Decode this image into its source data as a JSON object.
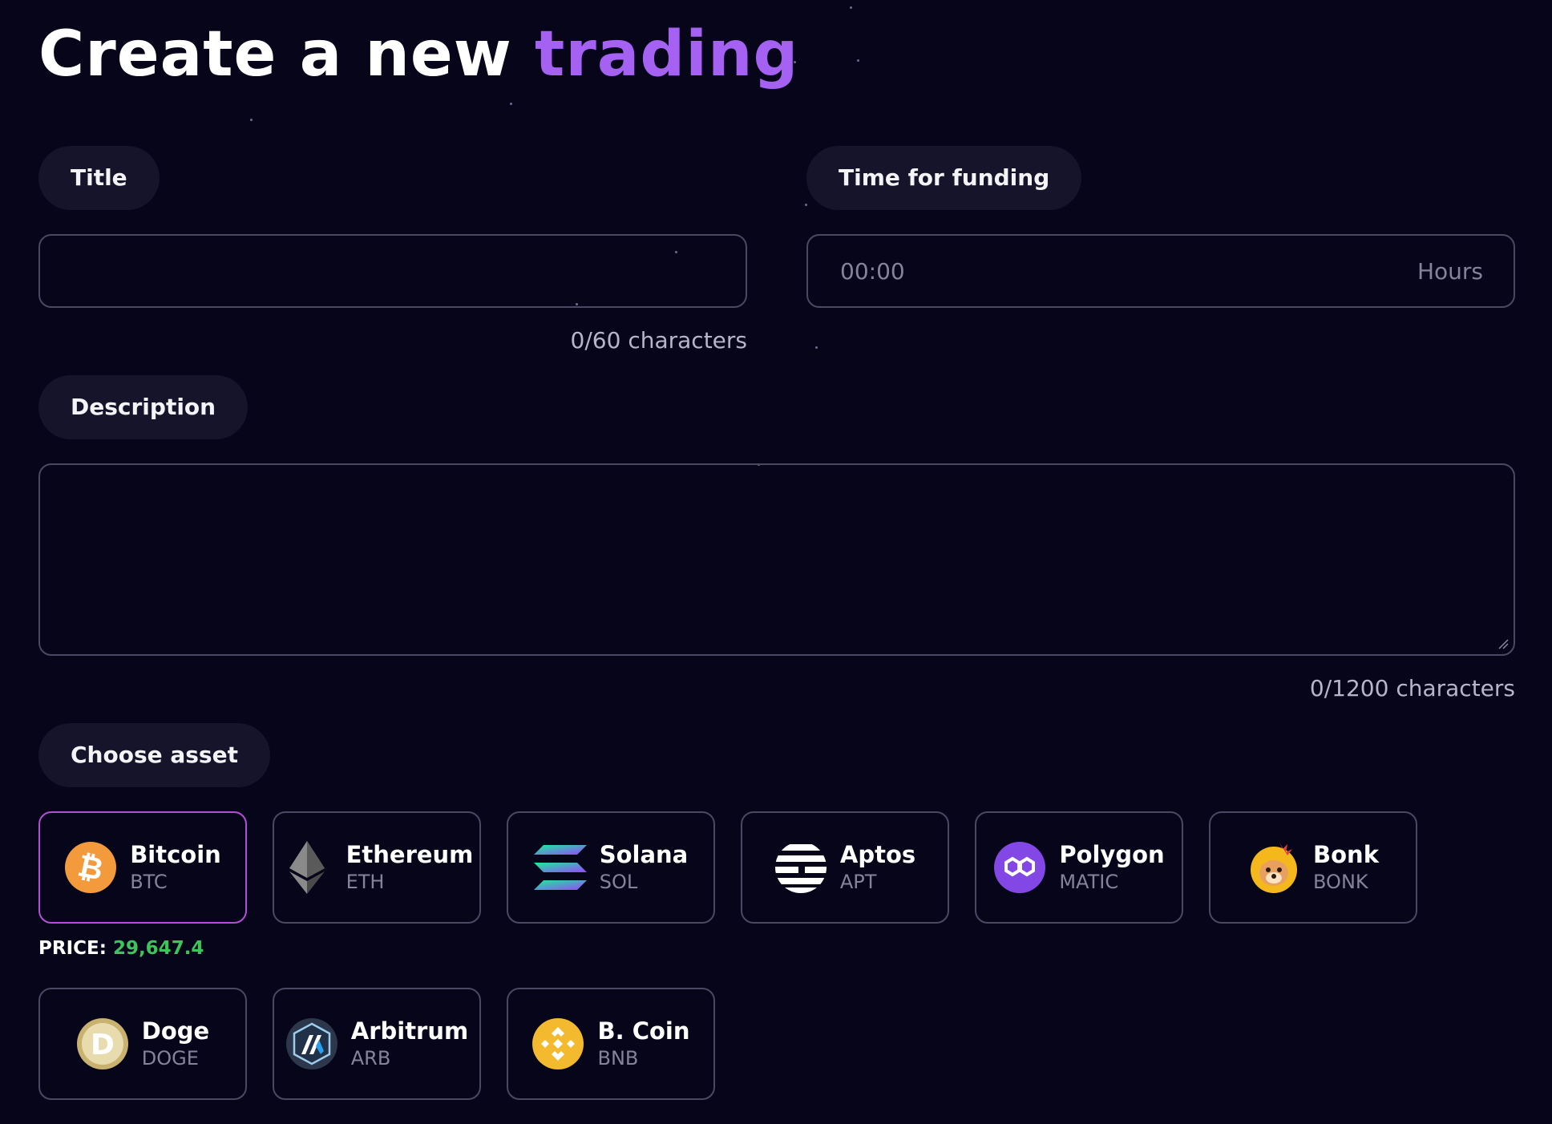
{
  "heading": {
    "text": "Create a new ",
    "accent": "trading"
  },
  "form": {
    "title_label": "Title",
    "title_value": "",
    "title_counter": "0/60 characters",
    "funding_label": "Time for funding",
    "funding_placeholder": "00:00",
    "funding_suffix": "Hours",
    "description_label": "Description",
    "description_value": "",
    "description_counter": "0/1200 characters",
    "asset_label": "Choose asset"
  },
  "assets": [
    {
      "name": "Bitcoin",
      "ticker": "BTC",
      "icon": "bitcoin-icon",
      "color": "#f29a3c",
      "selected": true
    },
    {
      "name": "Ethereum",
      "ticker": "ETH",
      "icon": "ethereum-icon",
      "color": "#8a8a8a",
      "selected": false
    },
    {
      "name": "Solana",
      "ticker": "SOL",
      "icon": "solana-icon",
      "color": "#14f195",
      "selected": false
    },
    {
      "name": "Aptos",
      "ticker": "APT",
      "icon": "aptos-icon",
      "color": "#ffffff",
      "selected": false
    },
    {
      "name": "Polygon",
      "ticker": "MATIC",
      "icon": "polygon-icon",
      "color": "#8247e5",
      "selected": false
    },
    {
      "name": "Bonk",
      "ticker": "BONK",
      "icon": "bonk-icon",
      "color": "#f5b81c",
      "selected": false
    },
    {
      "name": "Doge",
      "ticker": "DOGE",
      "icon": "doge-icon",
      "color": "#c9b270",
      "selected": false
    },
    {
      "name": "Arbitrum",
      "ticker": "ARB",
      "icon": "arbitrum-icon",
      "color": "#2d374b",
      "selected": false
    },
    {
      "name": "B. Coin",
      "ticker": "BNB",
      "icon": "bnb-icon",
      "color": "#f3ba2f",
      "selected": false
    }
  ],
  "price": {
    "label": "PRICE:",
    "value": "29,647.4"
  },
  "colors": {
    "background": "#07051a",
    "accent": "#a461f2",
    "price": "#3ec45a",
    "selected_border": "#b24fd6"
  }
}
